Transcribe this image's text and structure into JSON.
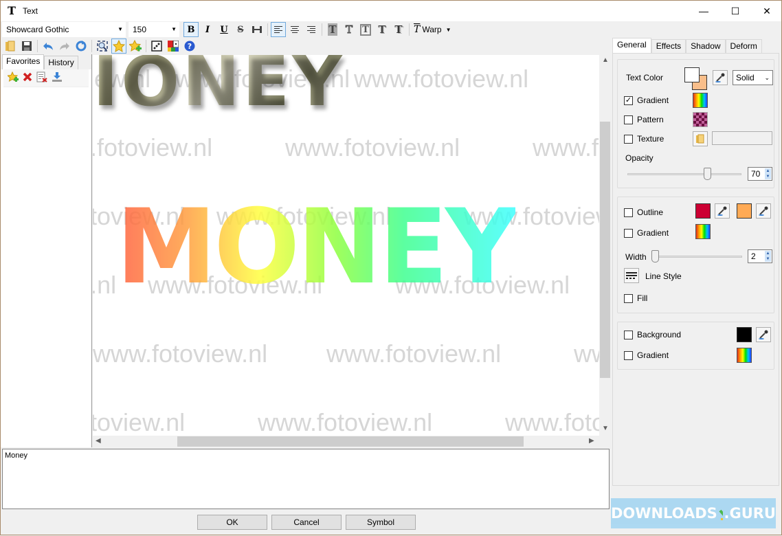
{
  "window": {
    "title": "Text",
    "controls": {
      "minimize": "—",
      "maximize": "☐",
      "close": "✕"
    }
  },
  "toolbar": {
    "font_name": "Showcard Gothic",
    "font_size": "150",
    "bold_label": "B",
    "italic_label": "I",
    "underline_label": "U",
    "strike_label": "S",
    "warp_label": "Warp",
    "style_glyph": "T",
    "bold_active": true,
    "align_left_active": true
  },
  "toolbar2": {
    "icons": [
      "open-folder",
      "save",
      "undo",
      "redo",
      "refresh",
      "zoom-fit",
      "favorite-star",
      "add-favorite",
      "dice",
      "color-palette",
      "help"
    ]
  },
  "left_panel": {
    "tabs": [
      {
        "label": "Favorites",
        "active": true
      },
      {
        "label": "History",
        "active": false
      }
    ],
    "tools": [
      "add-favorite",
      "delete",
      "delete-list",
      "import"
    ]
  },
  "canvas": {
    "preview_text_top": "IONEY",
    "preview_text_main": "MONEY",
    "watermark": "www.fotoview.nl"
  },
  "text_input": {
    "value": "Money"
  },
  "buttons": {
    "ok": "OK",
    "cancel": "Cancel",
    "symbol": "Symbol"
  },
  "right_panel": {
    "tabs": [
      {
        "label": "General",
        "active": true
      },
      {
        "label": "Effects",
        "active": false
      },
      {
        "label": "Shadow",
        "active": false
      },
      {
        "label": "Deform",
        "active": false
      }
    ],
    "fill": {
      "text_color_label": "Text Color",
      "primary_color": "#ffffff",
      "secondary_color": "#f9be8a",
      "fill_mode": "Solid",
      "gradient_label": "Gradient",
      "gradient_checked": true,
      "pattern_label": "Pattern",
      "pattern_checked": false,
      "texture_label": "Texture",
      "texture_checked": false,
      "texture_path": "",
      "opacity_label": "Opacity",
      "opacity_value": "70",
      "opacity_fraction": 0.7
    },
    "outline": {
      "outline_label": "Outline",
      "outline_checked": false,
      "color1": "#cc0033",
      "color2": "#ffaa55",
      "gradient_label": "Gradient",
      "gradient_checked": false,
      "width_label": "Width",
      "width_value": "2",
      "line_style_label": "Line Style",
      "fill_label": "Fill",
      "fill_checked": false
    },
    "background": {
      "background_label": "Background",
      "background_checked": false,
      "color": "#000000",
      "gradient_label": "Gradient",
      "gradient_checked": false
    }
  },
  "banner": {
    "text_left": "DOWNLOADS",
    "text_right": ".GURU"
  }
}
